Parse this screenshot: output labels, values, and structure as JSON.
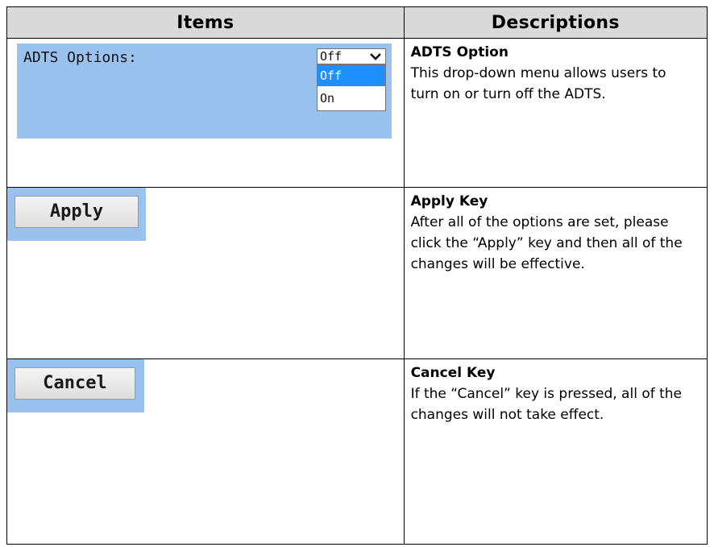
{
  "headers": {
    "items": "Items",
    "descriptions": "Descriptions"
  },
  "rows": [
    {
      "snapshot": {
        "label": "ADTS Options:",
        "selected_value": "Off",
        "options": [
          "Off",
          "On"
        ],
        "highlighted_option": "Off",
        "icon": "chevron-down-icon"
      },
      "title": "ADTS Option",
      "body": "This drop-down menu allows users to turn on or turn off the ADTS."
    },
    {
      "snapshot": {
        "button_label": "Apply"
      },
      "title": "Apply Key",
      "body": "After all of the options are set, please click the “Apply” key and then all of the changes will be effective."
    },
    {
      "snapshot": {
        "button_label": "Cancel"
      },
      "title": "Cancel Key",
      "body": "If the “Cancel” key is pressed, all of the changes will not take effect."
    }
  ],
  "colors": {
    "header_background": "#d9d9d9",
    "snapshot_background": "#99c3ee",
    "highlight_option": "#1e90ff"
  }
}
